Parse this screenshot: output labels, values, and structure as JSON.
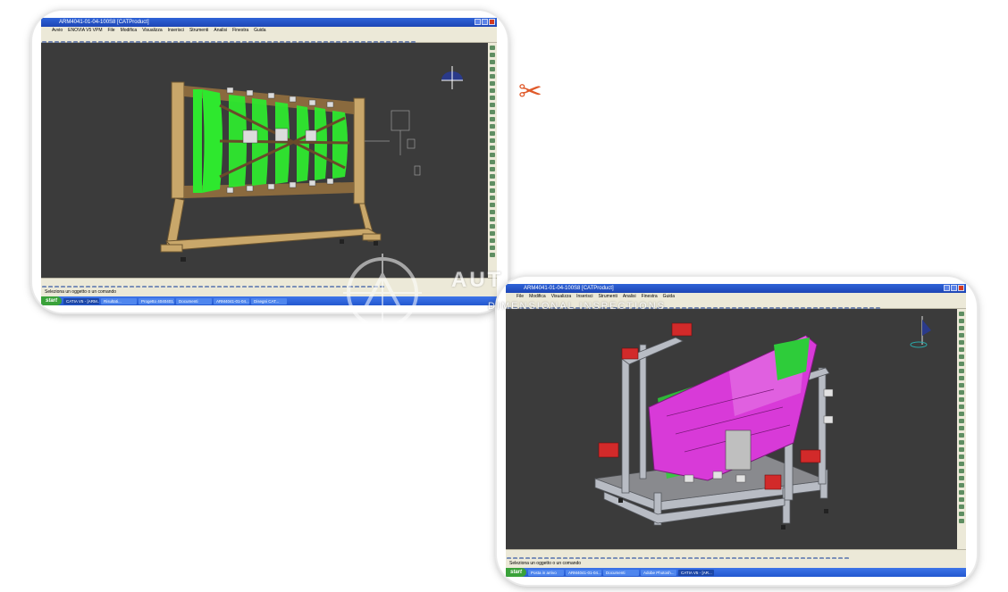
{
  "window1": {
    "title": "ARM4041-01-04-100S8 [CATProduct]",
    "menu": [
      "Avvio",
      "ENOVIA V5 VPM",
      "File",
      "Modifica",
      "Visualizza",
      "Inserisci",
      "Strumenti",
      "Analisi",
      "Finestra",
      "Guida"
    ],
    "status": "Seleziona un oggetto o un comando",
    "taskbar": {
      "start": "start",
      "items": [
        "CATIA V5 - [ARM...",
        "Risultati...",
        "Progetto 4040401...",
        "Documenti",
        "ARM4041-01-04...",
        "Disegni CAT..."
      ]
    }
  },
  "window2": {
    "title": "ARM4041-01-04-100S8 [CATProduct]",
    "menu": [
      "File",
      "Modifica",
      "Visualizza",
      "Inserisci",
      "Strumenti",
      "Analisi",
      "Finestra",
      "Guida"
    ],
    "status": "Seleziona un oggetto o un comando",
    "taskbar": {
      "start": "start",
      "items": [
        "Posta in arrivo",
        "ARM4041-01-04...",
        "Documenti",
        "Adobe Photosh...",
        "CATIA V5 - [AR..."
      ]
    }
  },
  "watermark": {
    "brand": "AUT",
    "subtitle": "DIMENSIONAL INSPECTIONS"
  },
  "colors": {
    "viewport_bg": "#3b3b3b",
    "green_panel": "#2ee82e",
    "magenta_part": "#d83ad8",
    "wood_frame": "#c9a76a",
    "accent_orange": "#e05a2a"
  },
  "icons": {
    "separator": "scissors-icon",
    "compass": "compass-icon"
  }
}
